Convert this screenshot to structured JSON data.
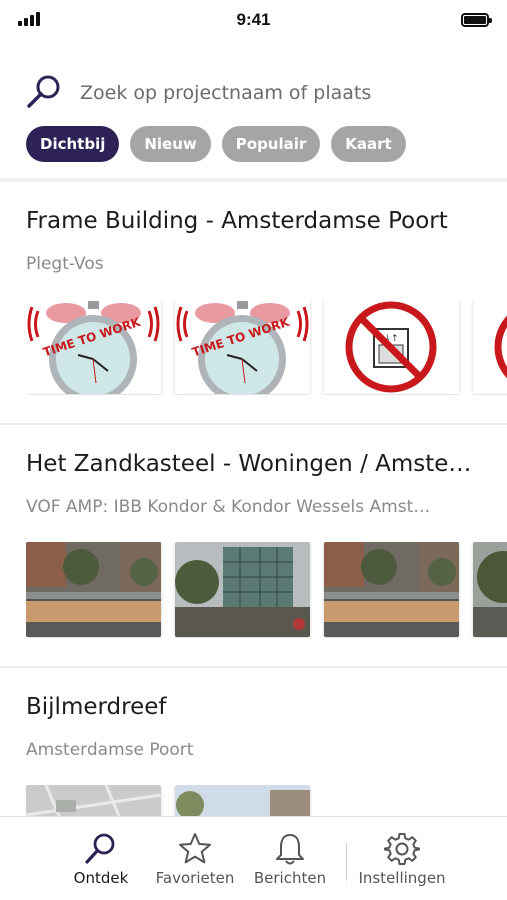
{
  "status_bar": {
    "time": "9:41"
  },
  "search": {
    "placeholder": "Zoek op projectnaam of plaats"
  },
  "filters": [
    {
      "label": "Dichtbij",
      "active": true
    },
    {
      "label": "Nieuw",
      "active": false
    },
    {
      "label": "Populair",
      "active": false
    },
    {
      "label": "Kaart",
      "active": false
    }
  ],
  "projects": [
    {
      "title": "Frame Building - Amsterdamse Poort",
      "subtitle": "Plegt-Vos",
      "thumbs": [
        "time-to-work-clock-image",
        "time-to-work-clock-image",
        "no-elevator-sign-image",
        "no-elevator-sign-image"
      ],
      "clock_text": "TIME TO WORK"
    },
    {
      "title": "Het Zandkasteel - Woningen / Amste…",
      "subtitle": "VOF AMP: IBB Kondor & Kondor Wessels Amst…",
      "thumbs": [
        "construction-fence-photo",
        "scaffolding-building-photo",
        "construction-fence-photo",
        "street-trees-photo"
      ]
    },
    {
      "title": "Bijlmerdreef",
      "subtitle": "Amsterdamse Poort",
      "thumbs": [
        "aerial-site-plan-photo",
        "street-view-photo"
      ]
    }
  ],
  "tab_bar": {
    "tabs": [
      {
        "label": "Ontdek",
        "icon": "search-icon",
        "active": true
      },
      {
        "label": "Favorieten",
        "icon": "star-icon",
        "active": false
      },
      {
        "label": "Berichten",
        "icon": "bell-icon",
        "active": false
      },
      {
        "label": "Instellingen",
        "icon": "gear-icon",
        "active": false
      }
    ]
  },
  "colors": {
    "accent": "#2e2156",
    "chip_inactive": "#a5a5a5",
    "subtitle": "#8a8a8a"
  }
}
